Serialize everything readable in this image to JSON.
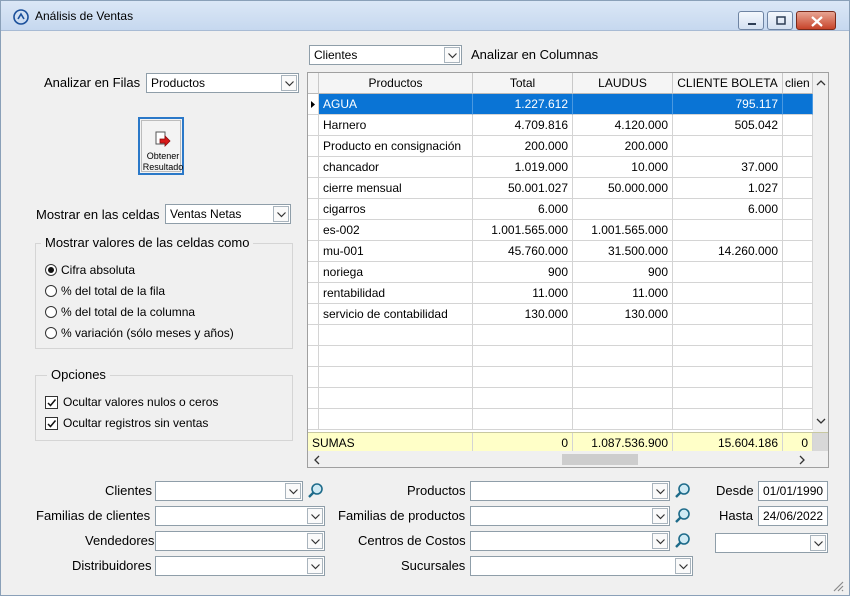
{
  "window": {
    "title": "Análisis de Ventas"
  },
  "top": {
    "columns_combo_value": "Clientes",
    "columns_label": "Analizar en Columnas",
    "rows_label": "Analizar en Filas",
    "rows_combo_value": "Productos",
    "get_button": {
      "line1": "Obtener",
      "line2": "Resultado"
    },
    "cells_label": "Mostrar en las celdas",
    "cells_combo_value": "Ventas Netas"
  },
  "display_group": {
    "title": "Mostrar valores de las celdas como",
    "options": [
      {
        "label": "Cifra absoluta",
        "selected": true
      },
      {
        "label": "% del total de la fila",
        "selected": false
      },
      {
        "label": "% del total de la columna",
        "selected": false
      },
      {
        "label": "% variación (sólo meses y años)",
        "selected": false
      }
    ]
  },
  "options_group": {
    "title": "Opciones",
    "checks": [
      {
        "label": "Ocultar valores nulos o ceros",
        "checked": true
      },
      {
        "label": "Ocultar registros sin ventas",
        "checked": true
      }
    ]
  },
  "grid": {
    "headers": [
      "Productos",
      "Total",
      "LAUDUS",
      "CLIENTE BOLETA",
      "clien"
    ],
    "rows": [
      [
        "AGUA",
        "1.227.612",
        "",
        "795.117"
      ],
      [
        "Harnero",
        "4.709.816",
        "4.120.000",
        "505.042"
      ],
      [
        "Producto en consignación",
        "200.000",
        "200.000",
        ""
      ],
      [
        "chancador",
        "1.019.000",
        "10.000",
        "37.000"
      ],
      [
        "cierre mensual",
        "50.001.027",
        "50.000.000",
        "1.027"
      ],
      [
        "cigarros",
        "6.000",
        "",
        "6.000"
      ],
      [
        "es-002",
        "1.001.565.000",
        "1.001.565.000",
        ""
      ],
      [
        "mu-001",
        "45.760.000",
        "31.500.000",
        "14.260.000"
      ],
      [
        "noriega",
        "900",
        "900",
        ""
      ],
      [
        "rentabilidad",
        "11.000",
        "11.000",
        ""
      ],
      [
        "servicio de contabilidad",
        "130.000",
        "130.000",
        ""
      ]
    ],
    "sums": [
      "SUMAS",
      "0",
      "1.087.536.900",
      "15.604.186",
      "0"
    ]
  },
  "filters": {
    "clientes": "Clientes",
    "familias_clientes": "Familias de clientes",
    "vendedores": "Vendedores",
    "distribuidores": "Distribuidores",
    "productos": "Productos",
    "familias_productos": "Familias de productos",
    "centros_costos": "Centros de Costos",
    "sucursales": "Sucursales",
    "desde_label": "Desde",
    "desde_value": "01/01/1990",
    "hasta_label": "Hasta",
    "hasta_value": "24/06/2022"
  },
  "colors": {
    "selection": "#0a74d5",
    "sums_bg": "#ffffc8",
    "accent_border": "#2a78c8"
  }
}
